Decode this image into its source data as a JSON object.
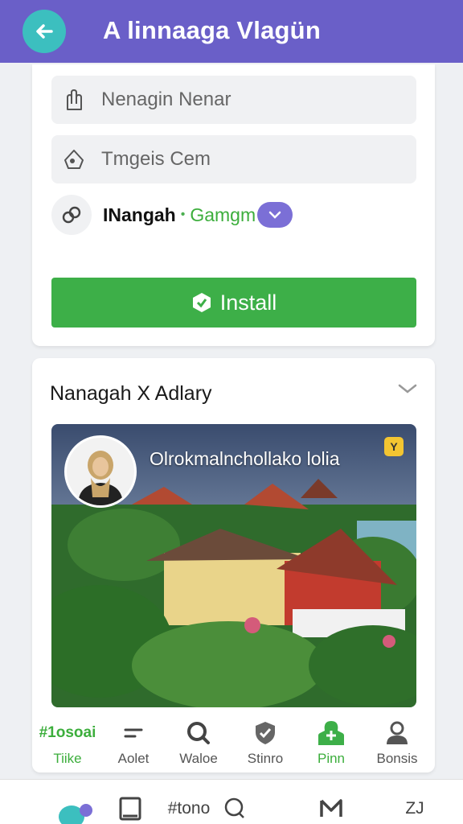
{
  "header": {
    "title": "A linnaaga Vlagün"
  },
  "form": {
    "field1": "Nenagin Nenar",
    "field2": "Tmgeis Cem",
    "link_name": "INangah",
    "link_sep": "•",
    "link_status": "Gamgm",
    "install_label": "Install"
  },
  "card": {
    "title": "Nanagah X Adlary",
    "caption": "Olrokmalnchollako lolia",
    "badge": "Y"
  },
  "actions": [
    {
      "icon_text": "#1osoai",
      "label": "Tiike"
    },
    {
      "label": "Aolet"
    },
    {
      "label": "Waloe"
    },
    {
      "label": "Stinro"
    },
    {
      "label": "Pinn"
    },
    {
      "label": "Bonsis"
    }
  ],
  "bottom_nav": {
    "item3": "#tono",
    "item6": "ZJ"
  },
  "colors": {
    "header": "#6a5fc8",
    "back": "#3cbfbf",
    "install": "#3daf48",
    "accent": "#7b6fd6"
  }
}
